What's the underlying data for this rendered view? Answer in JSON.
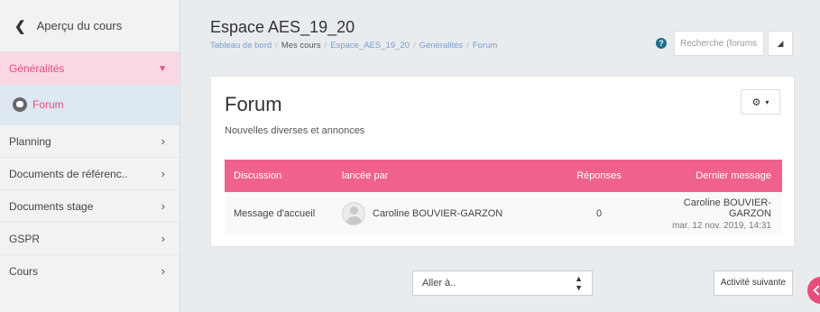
{
  "sidebar": {
    "back_label": "Aperçu du cours",
    "active_section": "Généralités",
    "active_item": "Forum",
    "items": [
      {
        "label": "Planning"
      },
      {
        "label": "Documents de référenc.."
      },
      {
        "label": "Documents stage"
      },
      {
        "label": "GSPR"
      },
      {
        "label": "Cours"
      }
    ]
  },
  "header": {
    "title": "Espace AES_19_20",
    "breadcrumb": [
      "Tableau de bord",
      "Mes cours",
      "Espace_AES_19_20",
      "Généralités",
      "Forum"
    ],
    "search_placeholder": "Recherche (forums",
    "help_glyph": "?"
  },
  "forum": {
    "title": "Forum",
    "subtitle": "Nouvelles diverses et annonces",
    "columns": [
      "Discussion",
      "lancée par",
      "Réponses",
      "Dernier message"
    ],
    "rows": [
      {
        "discussion": "Message d'accueil",
        "author": "Caroline BOUVIER-GARZON",
        "replies": "0",
        "last_author": "Caroline BOUVIER-GARZON",
        "last_date": "mar. 12 nov. 2019, 14:31"
      }
    ]
  },
  "footer": {
    "jump_label": "Aller à..",
    "next_label": "Activité suivante"
  },
  "colors": {
    "accent": "#e74c7c",
    "table_header": "#f0628b",
    "link": "#7a9ccc"
  }
}
